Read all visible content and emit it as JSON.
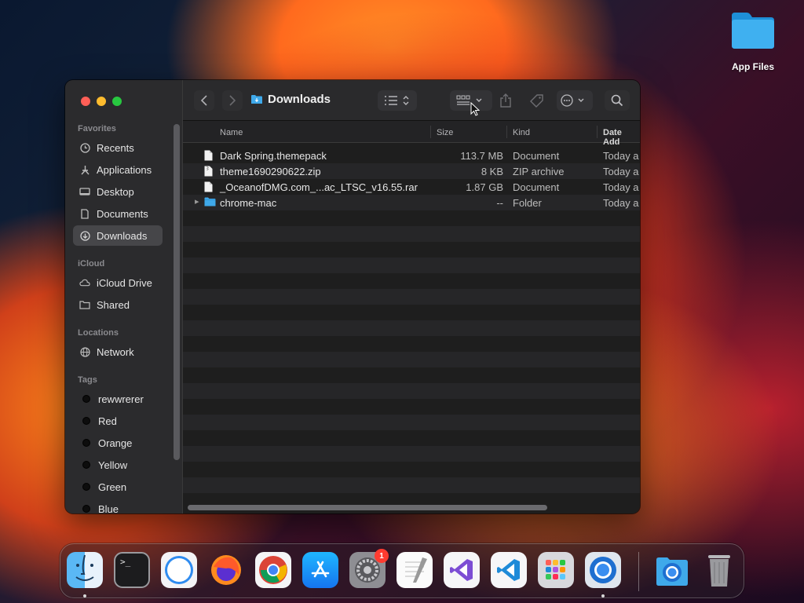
{
  "desktop": {
    "icons": [
      {
        "label": "App Files",
        "icon": "folder-icon"
      }
    ]
  },
  "window": {
    "title": "Downloads",
    "sidebar": {
      "sections": {
        "favorites": "Favorites",
        "icloud": "iCloud",
        "locations": "Locations",
        "tags": "Tags"
      },
      "favorites": [
        {
          "label": "Recents",
          "icon": "clock-icon"
        },
        {
          "label": "Applications",
          "icon": "applications-icon"
        },
        {
          "label": "Desktop",
          "icon": "desktop-icon"
        },
        {
          "label": "Documents",
          "icon": "document-icon"
        },
        {
          "label": "Downloads",
          "icon": "download-icon",
          "selected": true
        }
      ],
      "icloud": [
        {
          "label": "iCloud Drive",
          "icon": "cloud-icon"
        },
        {
          "label": "Shared",
          "icon": "shared-folder-icon"
        }
      ],
      "locations": [
        {
          "label": "Network",
          "icon": "network-globe-icon"
        }
      ],
      "tags": [
        {
          "label": "rewwrerer"
        },
        {
          "label": "Red"
        },
        {
          "label": "Orange"
        },
        {
          "label": "Yellow"
        },
        {
          "label": "Green"
        },
        {
          "label": "Blue"
        }
      ]
    },
    "columns": {
      "name": "Name",
      "size": "Size",
      "kind": "Kind",
      "date": "Date Add"
    },
    "files": [
      {
        "name": "Dark Spring.themepack",
        "size": "113.7 MB",
        "kind": "Document",
        "date": "Today a",
        "type": "file"
      },
      {
        "name": "theme1690290622.zip",
        "size": "8 KB",
        "kind": "ZIP archive",
        "date": "Today a",
        "type": "zip"
      },
      {
        "name": "_OceanofDMG.com_...ac_LTSC_v16.55.rar",
        "size": "1.87 GB",
        "kind": "Document",
        "date": "Today a",
        "type": "file"
      },
      {
        "name": "chrome-mac",
        "size": "--",
        "kind": "Folder",
        "date": "Today a",
        "type": "folder"
      }
    ]
  },
  "dock": {
    "apps": [
      {
        "name": "Finder",
        "running": true
      },
      {
        "name": "Terminal",
        "running": false
      },
      {
        "name": "Safari",
        "running": false
      },
      {
        "name": "Firefox",
        "running": false
      },
      {
        "name": "Chrome",
        "running": false
      },
      {
        "name": "App Store",
        "running": false
      },
      {
        "name": "System Settings",
        "badge": "1",
        "running": false
      },
      {
        "name": "TextEdit",
        "running": false
      },
      {
        "name": "Visual Studio",
        "running": false
      },
      {
        "name": "VS Code",
        "running": false
      },
      {
        "name": "Launchpad",
        "running": false
      },
      {
        "name": "Chromium",
        "running": true
      },
      {
        "name": "Downloads Stack",
        "running": false
      },
      {
        "name": "Trash",
        "running": false
      }
    ]
  }
}
